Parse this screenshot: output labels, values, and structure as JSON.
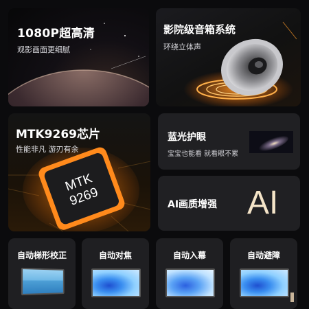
{
  "cards": {
    "resolution": {
      "title": "1080P超高清",
      "subtitle": "观影画面更细腻"
    },
    "audio": {
      "title": "影院级音箱系统",
      "subtitle": "环绕立体声"
    },
    "chip": {
      "title": "MTK9269芯片",
      "subtitle": "性能非凡 游刃有余",
      "chip_label_line1": "MTK",
      "chip_label_line2": "9269"
    },
    "eye_care": {
      "title": "蓝光护眼",
      "subtitle": "宝宝也能看 就看眼不累"
    },
    "ai": {
      "title": "AI画质增强",
      "badge": "AI"
    }
  },
  "features": [
    {
      "label": "自动梯形校正"
    },
    {
      "label": "自动对焦"
    },
    {
      "label": "自动入幕"
    },
    {
      "label": "自动避障"
    }
  ],
  "colors": {
    "background": "#0b0b0d",
    "card": "#202023",
    "accent_orange": "#ff8a1c",
    "ai_text": "#f4e4c8"
  }
}
